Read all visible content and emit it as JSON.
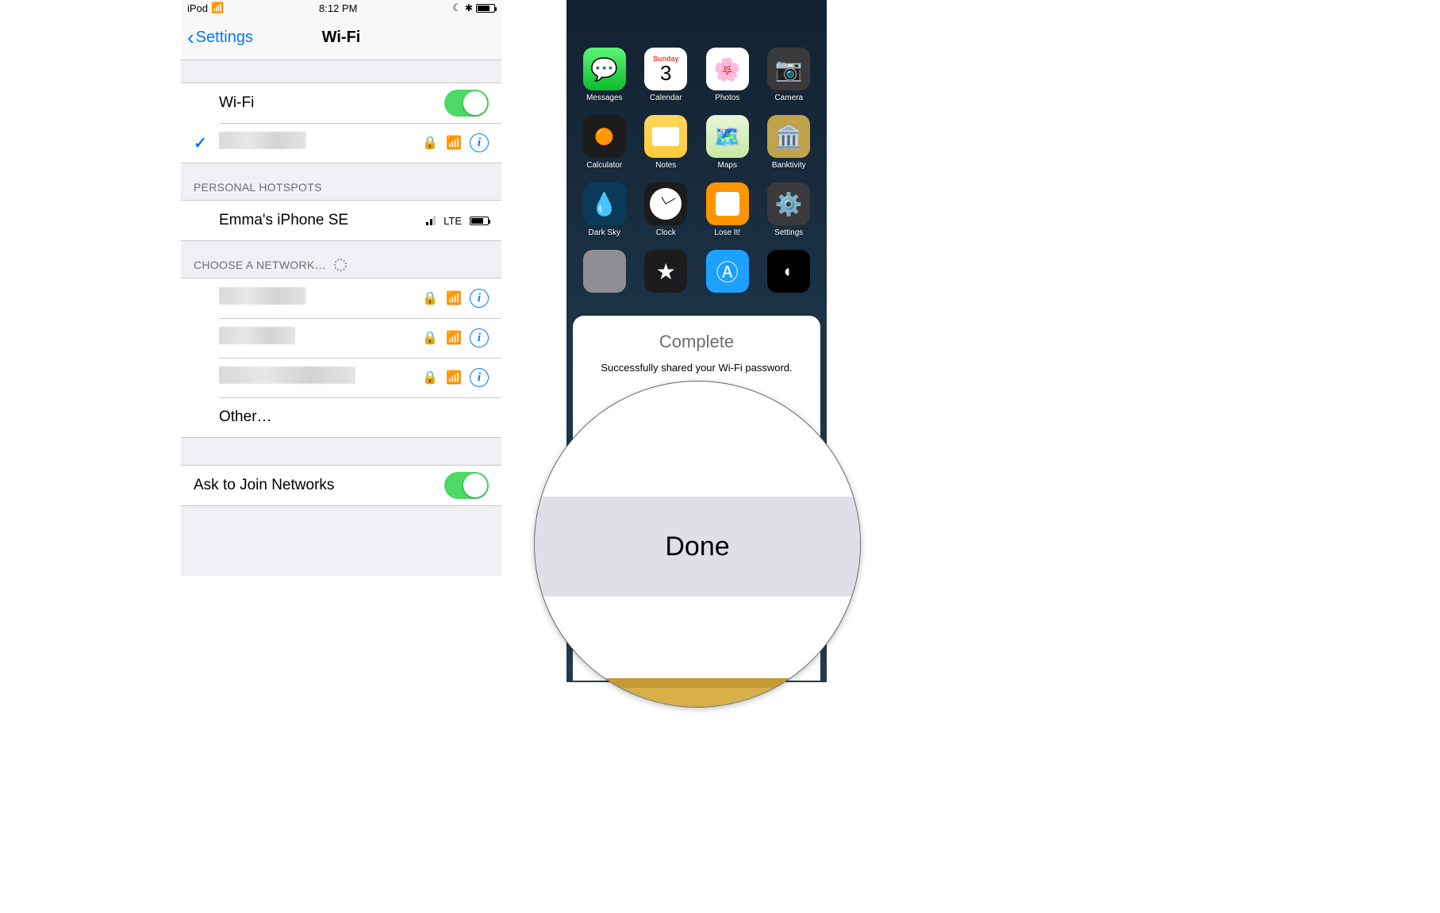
{
  "left": {
    "statusbar": {
      "device": "iPod",
      "time": "8:12 PM"
    },
    "navbar": {
      "back": "Settings",
      "title": "Wi-Fi"
    },
    "wifi_row_label": "Wi-Fi",
    "sections": {
      "hotspots_header": "PERSONAL HOTSPOTS",
      "choose_header": "CHOOSE A NETWORK…"
    },
    "hotspot": {
      "name": "Emma's iPhone SE",
      "carrier": "LTE"
    },
    "other_label": "Other…",
    "ask_to_join_label": "Ask to Join Networks"
  },
  "right": {
    "calendar": {
      "dow": "Sunday",
      "day": "3"
    },
    "apps": {
      "messages": "Messages",
      "calendar": "Calendar",
      "photos": "Photos",
      "camera": "Camera",
      "calculator": "Calculator",
      "notes": "Notes",
      "maps": "Maps",
      "banktivity": "Banktivity",
      "darksky": "Dark Sky",
      "clock": "Clock",
      "loseit": "Lose It!",
      "settings": "Settings"
    },
    "sheet": {
      "title": "Complete",
      "message": "Successfully shared your Wi-Fi password.",
      "done": "Done"
    }
  }
}
